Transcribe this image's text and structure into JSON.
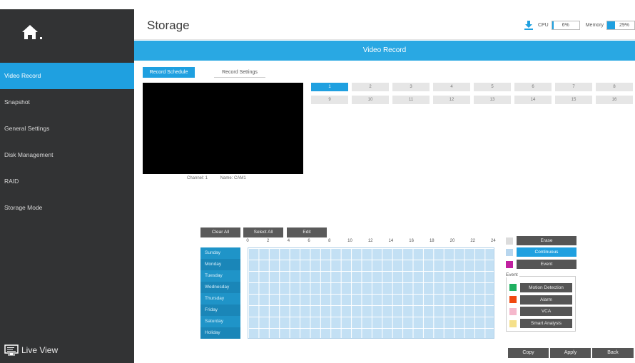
{
  "header": {
    "title": "Storage",
    "cpu_label": "CPU",
    "cpu_value": "6%",
    "cpu_level": 0.06,
    "mem_label": "Memory",
    "mem_value": "29%",
    "mem_level": 0.29
  },
  "banner": {
    "title": "Video Record"
  },
  "sidebar": {
    "items": [
      {
        "label": "Video Record"
      },
      {
        "label": "Snapshot"
      },
      {
        "label": "General Settings"
      },
      {
        "label": "Disk Management"
      },
      {
        "label": "RAID"
      },
      {
        "label": "Storage Mode"
      }
    ],
    "live_view": "Live View"
  },
  "tabs": {
    "record_schedule": "Record Schedule",
    "record_settings": "Record Settings"
  },
  "video": {
    "channel": "Channel: 1",
    "name": "Name: CAM1"
  },
  "channels": [
    "1",
    "2",
    "3",
    "4",
    "5",
    "6",
    "7",
    "8",
    "9",
    "10",
    "11",
    "12",
    "13",
    "14",
    "15",
    "16"
  ],
  "schedule": {
    "clear_all": "Clear All",
    "select_all": "Select All",
    "edit": "Edit",
    "hours": [
      "0",
      "2",
      "4",
      "6",
      "8",
      "10",
      "12",
      "14",
      "16",
      "18",
      "20",
      "22",
      "24"
    ],
    "days": [
      "Sunday",
      "Monday",
      "Tuesday",
      "Wednesday",
      "Thursday",
      "Friday",
      "Saturday",
      "Holiday"
    ]
  },
  "legend": {
    "erase": "Erase",
    "continuous": "Continuous",
    "event": "Event",
    "event_group": "Event",
    "motion": "Motion Detection",
    "alarm": "Alarm",
    "vca": "VCA",
    "smart": "Smart Analysis",
    "colors": {
      "erase": "#dcdcdc",
      "continuous": "#b8d6ee",
      "event": "#c020a0",
      "motion": "#1fb060",
      "alarm": "#f04810",
      "vca": "#f5b8cc",
      "smart": "#f5e08a"
    }
  },
  "actions": {
    "copy": "Copy",
    "apply": "Apply",
    "back": "Back"
  }
}
